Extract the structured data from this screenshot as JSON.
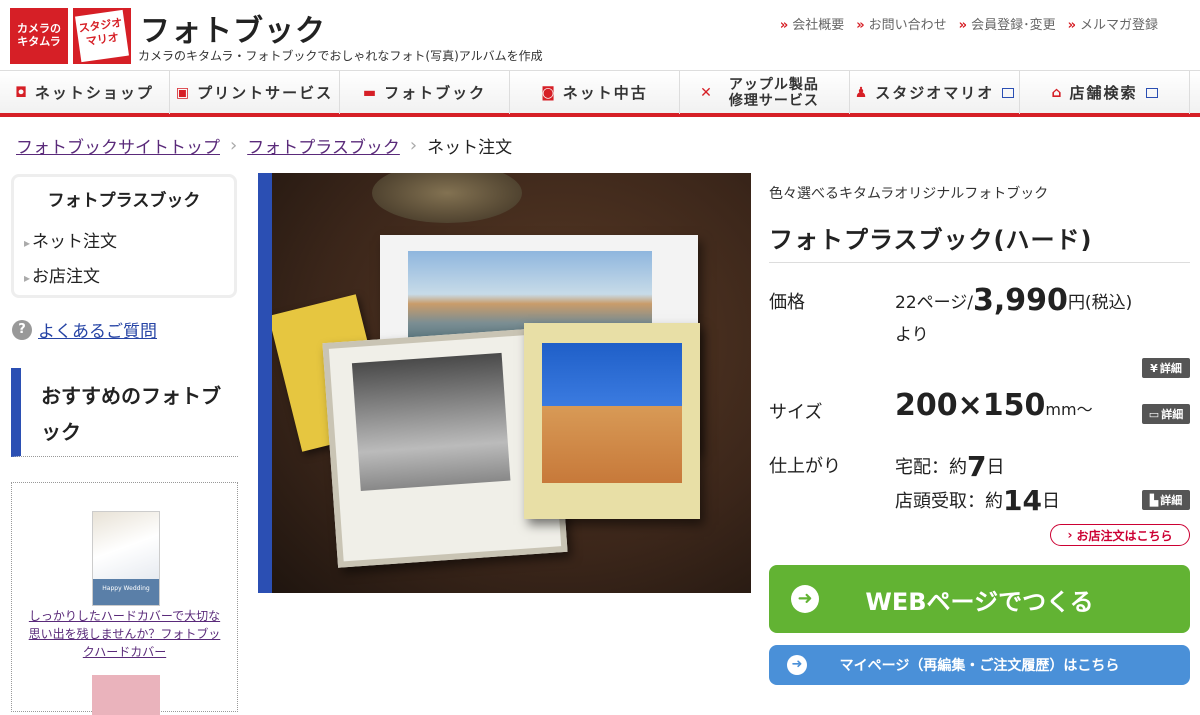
{
  "header": {
    "logo1": "カメラのキタムラ",
    "logo2": "スタジオマリオ",
    "site_title": "フォトブック",
    "tagline": "カメラのキタムラ・フォトブックでおしゃれなフォト(写真)アルバムを作成",
    "links": [
      "会社概要",
      "お問い合わせ",
      "会員登録･変更",
      "メルマガ登録"
    ]
  },
  "nav": {
    "items": [
      {
        "label": "ネットショップ",
        "icon": "camera-icon"
      },
      {
        "label": "プリントサービス",
        "icon": "print-icon"
      },
      {
        "label": "フォトブック",
        "icon": "book-icon"
      },
      {
        "label": "ネット中古",
        "icon": "used-icon"
      },
      {
        "label": "アップル製品 修理サービス",
        "icon": "tools-icon"
      },
      {
        "label": "スタジオマリオ",
        "icon": "studio-icon"
      },
      {
        "label": "店舗検索",
        "icon": "home-icon"
      }
    ]
  },
  "breadcrumb": [
    "フォトブックサイトトップ",
    "フォトプラスブック",
    "ネット注文"
  ],
  "sidebar": {
    "box_title": "フォトプラスブック",
    "items": [
      "ネット注文",
      "お店注文"
    ],
    "faq": "よくあるご質問",
    "faq_icon": "?",
    "recommend_title": "おすすめのフォトブック",
    "rec_caption": "しっかりしたハードカバーで大切な思い出を残しませんか？フォトブックハードカバー",
    "rec_thumb_text": "Happy Wedding"
  },
  "product": {
    "subhead": "色々選べるキタムラオリジナルフォトブック",
    "title": "フォトプラスブック(ハード)",
    "price_label": "価格",
    "price_prefix": "22ページ/",
    "price_value": "3,990",
    "price_suffix": "円(税込)",
    "price_tail": "より",
    "size_label": "サイズ",
    "size_value": "200×150",
    "size_unit": "mm～",
    "finish_label": "仕上がり",
    "delivery_prefix": "宅配：約",
    "delivery_days": "7",
    "store_prefix": "店頭受取：約",
    "store_days": "14",
    "day_unit": "日",
    "detail": "詳細",
    "store_order": "お店注文はこちら",
    "web_button": "WEBページでつくる",
    "mypage_button": "マイページ（再編集・ご注文履歴）はこちら"
  },
  "colors": {
    "brand": "#d61f26",
    "accent": "#2b4fb3",
    "web": "#62b333",
    "mypage": "#4a90d8"
  }
}
